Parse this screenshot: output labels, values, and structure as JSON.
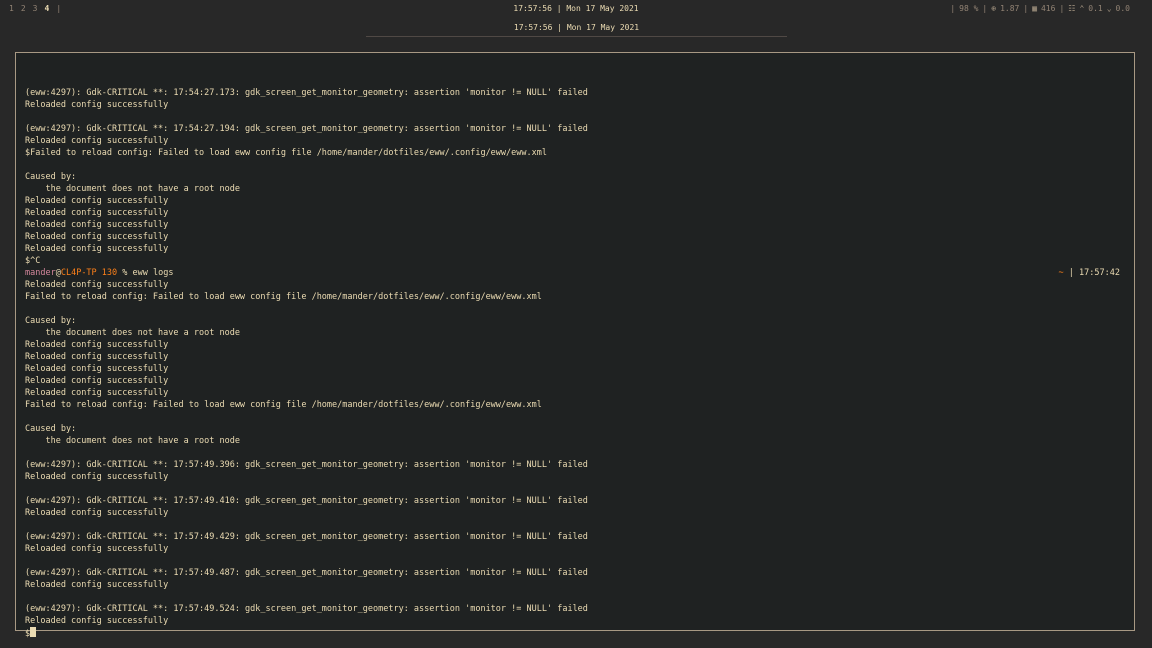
{
  "topbar": {
    "workspaces": [
      "1",
      "2",
      "3",
      "4"
    ],
    "active_workspace_index": 3,
    "separator": "|",
    "clock": "17:57:56 | Mon 17 May 2021",
    "sys": {
      "sep1": "|",
      "volume": "98 %",
      "sep2": "|",
      "cpu_icon": "cpu-icon",
      "cpu": "1.87",
      "sep3": "|",
      "mem_icon": "memory-icon",
      "mem": "416",
      "sep4": "|",
      "net_icon": "network-icon",
      "up": "0.1",
      "down": "0.0"
    }
  },
  "popup": {
    "clock": "17:57:56 | Mon 17 May 2021"
  },
  "terminal": {
    "lines_before_prompt": [
      "(eww:4297): Gdk-CRITICAL **: 17:54:27.173: gdk_screen_get_monitor_geometry: assertion 'monitor != NULL' failed",
      "Reloaded config successfully",
      "",
      "(eww:4297): Gdk-CRITICAL **: 17:54:27.194: gdk_screen_get_monitor_geometry: assertion 'monitor != NULL' failed",
      "Reloaded config successfully",
      "$Failed to reload config: Failed to load eww config file /home/mander/dotfiles/eww/.config/eww/eww.xml",
      "",
      "Caused by:",
      "    the document does not have a root node",
      "Reloaded config successfully",
      "Reloaded config successfully",
      "Reloaded config successfully",
      "Reloaded config successfully",
      "Reloaded config successfully",
      "$^C"
    ],
    "prompt": {
      "user": "mander",
      "at": "@",
      "host": "CL4P-TP",
      "code": "130",
      "symbol": "%",
      "command": "eww logs",
      "rprompt_dir": "~",
      "rprompt_sep": "|",
      "rprompt_time": "17:57:42"
    },
    "lines_after_prompt": [
      "Reloaded config successfully",
      "Failed to reload config: Failed to load eww config file /home/mander/dotfiles/eww/.config/eww/eww.xml",
      "",
      "Caused by:",
      "    the document does not have a root node",
      "Reloaded config successfully",
      "Reloaded config successfully",
      "Reloaded config successfully",
      "Reloaded config successfully",
      "Reloaded config successfully",
      "Failed to reload config: Failed to load eww config file /home/mander/dotfiles/eww/.config/eww/eww.xml",
      "",
      "Caused by:",
      "    the document does not have a root node",
      "",
      "(eww:4297): Gdk-CRITICAL **: 17:57:49.396: gdk_screen_get_monitor_geometry: assertion 'monitor != NULL' failed",
      "Reloaded config successfully",
      "",
      "(eww:4297): Gdk-CRITICAL **: 17:57:49.410: gdk_screen_get_monitor_geometry: assertion 'monitor != NULL' failed",
      "Reloaded config successfully",
      "",
      "(eww:4297): Gdk-CRITICAL **: 17:57:49.429: gdk_screen_get_monitor_geometry: assertion 'monitor != NULL' failed",
      "Reloaded config successfully",
      "",
      "(eww:4297): Gdk-CRITICAL **: 17:57:49.487: gdk_screen_get_monitor_geometry: assertion 'monitor != NULL' failed",
      "Reloaded config successfully",
      "",
      "(eww:4297): Gdk-CRITICAL **: 17:57:49.524: gdk_screen_get_monitor_geometry: assertion 'monitor != NULL' failed",
      "Reloaded config successfully"
    ],
    "final_prompt": "$"
  }
}
